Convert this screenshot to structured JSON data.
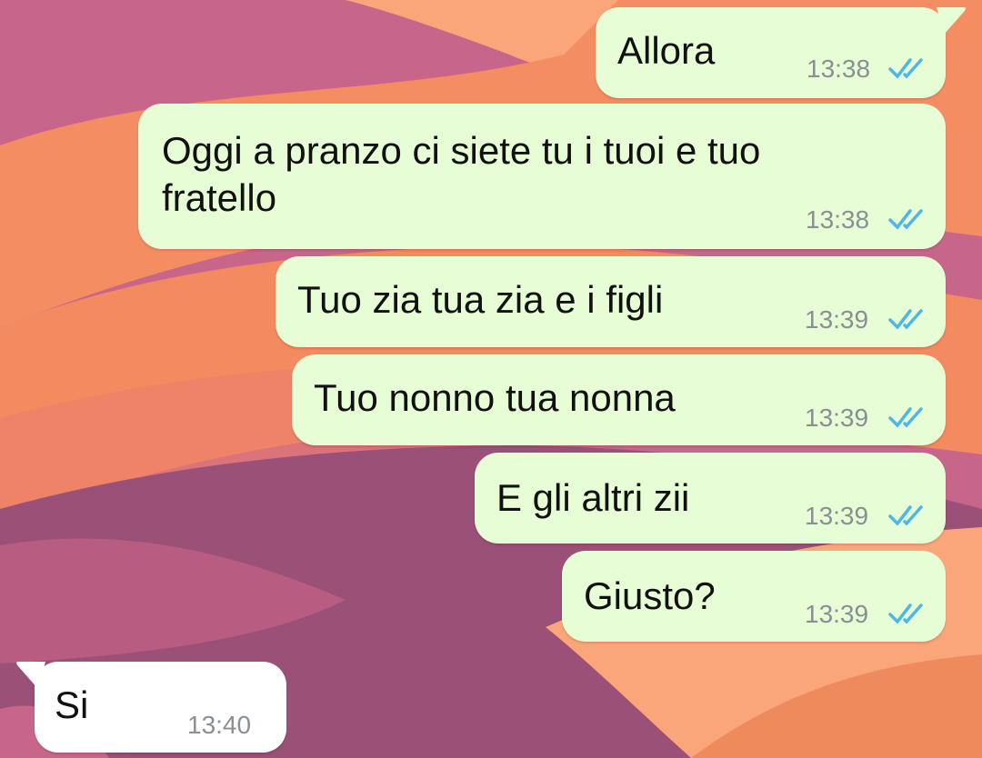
{
  "theme": {
    "outgoing_bubble": "#e7fdd6",
    "incoming_bubble": "#ffffff",
    "tick_color": "#4fb6ec",
    "wallpaper": [
      "#c7668a",
      "#f58d63",
      "#fba57a",
      "#9a5077",
      "#ef8a5c"
    ]
  },
  "messages": [
    {
      "direction": "outgoing",
      "text": "Allora",
      "time": "13:38",
      "status": "double-check-icon"
    },
    {
      "direction": "outgoing",
      "text_lines": [
        "Oggi a pranzo ci siete tu i tuoi e tuo",
        "fratello"
      ],
      "time": "13:38",
      "status": "double-check-icon"
    },
    {
      "direction": "outgoing",
      "text": "Tuo zia tua zia e i figli",
      "time": "13:39",
      "status": "double-check-icon"
    },
    {
      "direction": "outgoing",
      "text": "Tuo nonno tua nonna",
      "time": "13:39",
      "status": "double-check-icon"
    },
    {
      "direction": "outgoing",
      "text": "E gli altri zii",
      "time": "13:39",
      "status": "double-check-icon"
    },
    {
      "direction": "outgoing",
      "text": "Giusto?",
      "time": "13:39",
      "status": "double-check-icon"
    },
    {
      "direction": "incoming",
      "text": "Si",
      "time": "13:40"
    }
  ]
}
